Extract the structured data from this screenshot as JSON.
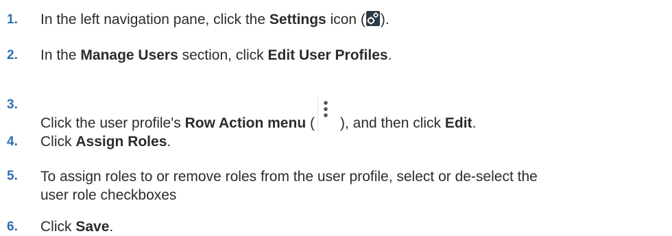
{
  "steps": [
    {
      "number": "1.",
      "t1": "In the left navigation pane, click the ",
      "b1": "Settings",
      "t2": " icon (",
      "icon": "settings-gear-icon",
      "t3": ")."
    },
    {
      "number": "2.",
      "t1": "In the ",
      "b1": "Manage Users",
      "t2": " section, click ",
      "b2": "Edit User Profiles",
      "t3": "."
    },
    {
      "number": "3.",
      "t1": "Click the user profile's ",
      "b1": "Row Action menu",
      "t2": " (",
      "icon": "kebab-menu-icon",
      "t3": "), and then click ",
      "b2": "Edit",
      "t4": "."
    },
    {
      "number": "4.",
      "t1": "Click ",
      "b1": "Assign Roles",
      "t2": "."
    },
    {
      "number": "5.",
      "line1": "To assign roles to or remove roles from the user profile, select or de-select the",
      "line2": "user role checkboxes"
    },
    {
      "number": "6.",
      "t1": "Click ",
      "b1": "Save",
      "t2": "."
    }
  ]
}
